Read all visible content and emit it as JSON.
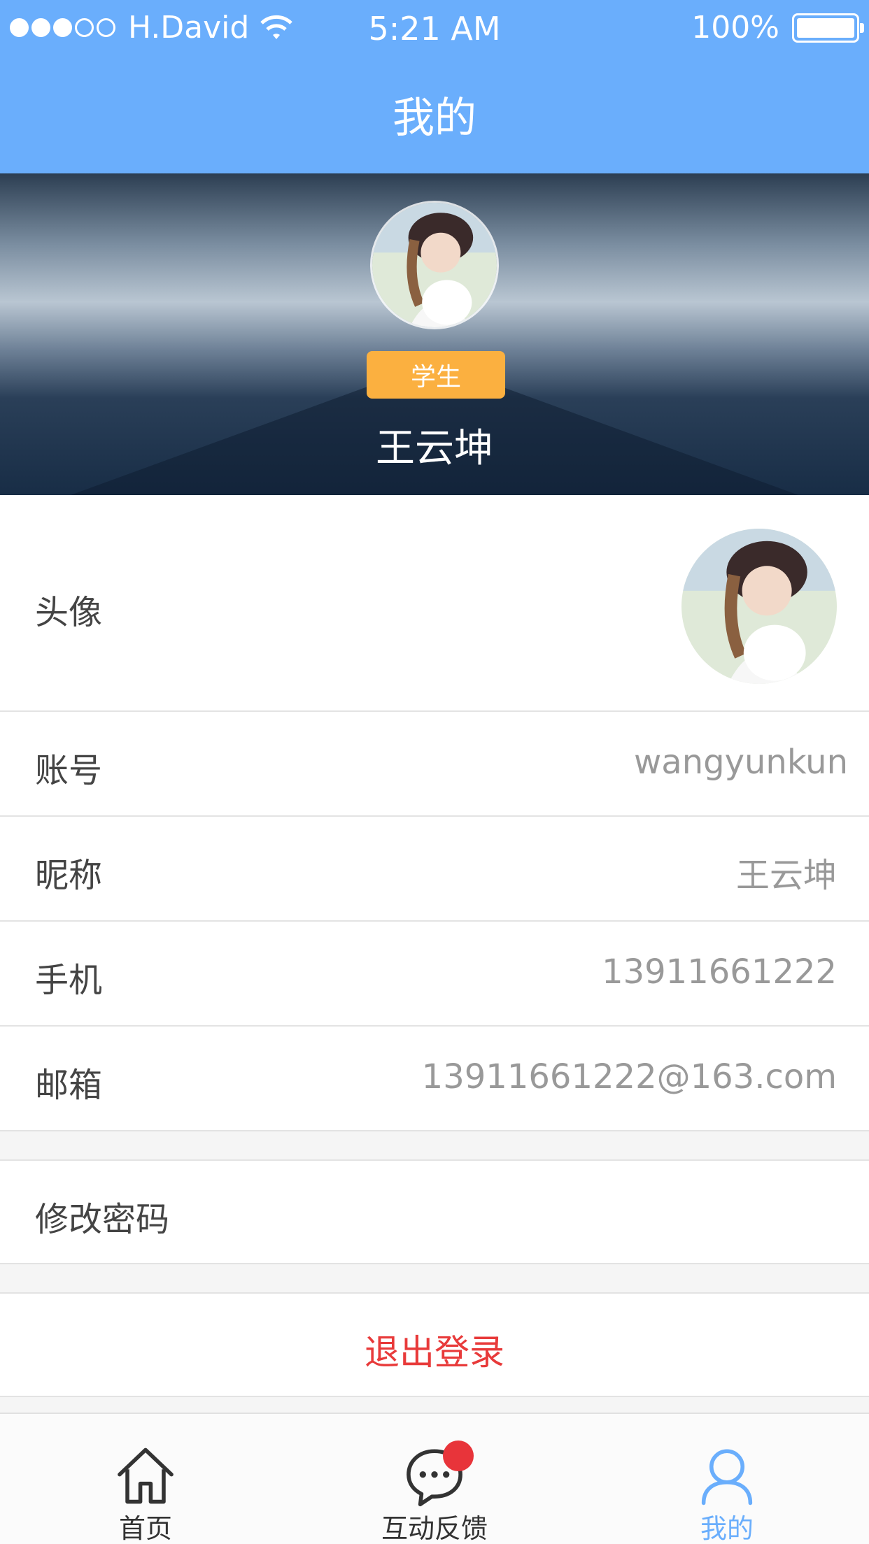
{
  "status_bar": {
    "carrier": "H.David",
    "time": "5:21 AM",
    "battery": "100%"
  },
  "header": {
    "title": "我的"
  },
  "profile": {
    "role": "学生",
    "name": "王云坤"
  },
  "rows": {
    "avatar_label": "头像",
    "account_label": "账号",
    "account_value": "wangyunkun",
    "nickname_label": "昵称",
    "nickname_value": "王云坤",
    "phone_label": "手机",
    "phone_value": "13911661222",
    "email_label": "邮箱",
    "email_value": "13911661222@163.com",
    "change_password_label": "修改密码",
    "logout_label": "退出登录"
  },
  "tabbar": {
    "tabs": [
      {
        "label": "首页",
        "icon": "home-icon"
      },
      {
        "label": "互动反馈",
        "icon": "chat-bubble-icon"
      },
      {
        "label": "我的",
        "icon": "user-icon"
      }
    ]
  },
  "colors": {
    "accent": "#6aaefc",
    "badge": "#fbb040",
    "logout": "#e83a3a",
    "notification": "#e8343a"
  }
}
